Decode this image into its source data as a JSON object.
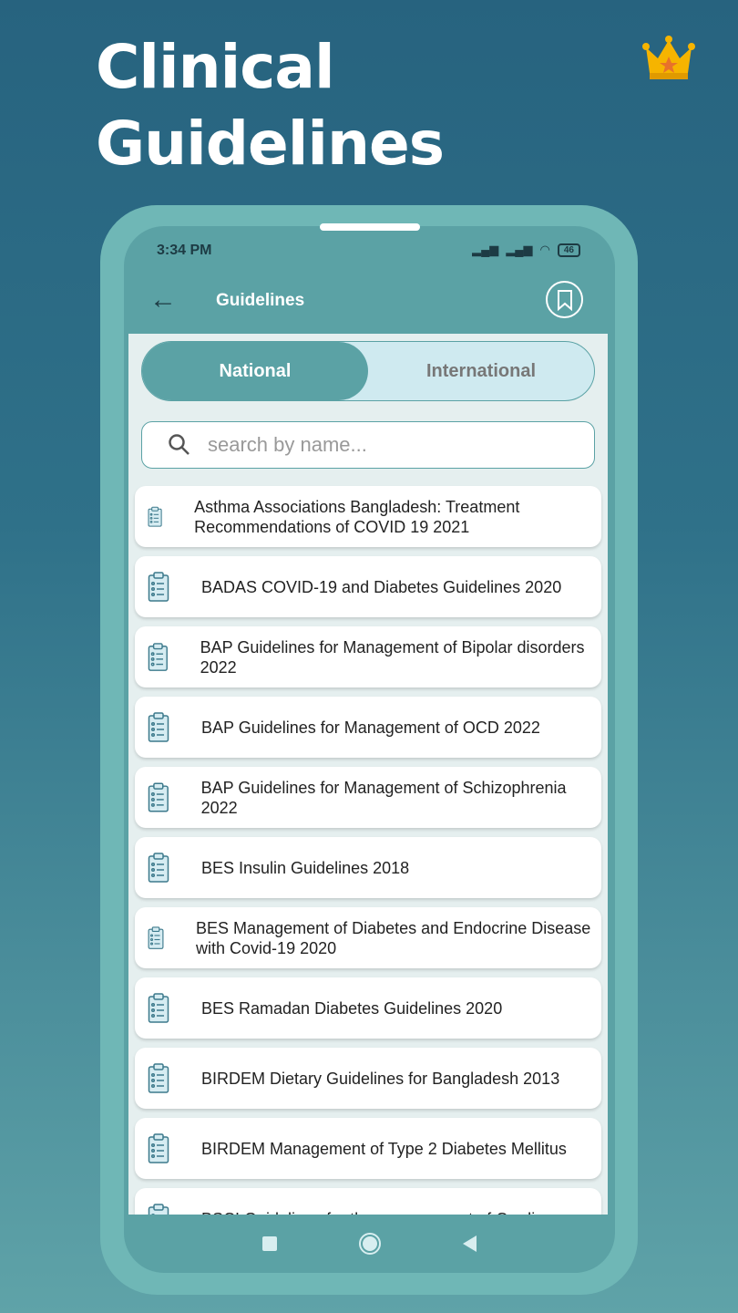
{
  "headline": {
    "line1": "Clinical",
    "line2": "Guidelines"
  },
  "status_bar": {
    "time": "3:34 PM",
    "battery": "46"
  },
  "app_bar": {
    "title": "Guidelines"
  },
  "tabs": [
    {
      "label": "National",
      "active": true
    },
    {
      "label": "International",
      "active": false
    }
  ],
  "search": {
    "placeholder": "search by name...",
    "value": ""
  },
  "guidelines": [
    "Asthma Associations Bangladesh: Treatment Recommendations of COVID 19 2021",
    "BADAS COVID-19 and Diabetes Guidelines 2020",
    "BAP Guidelines for Management of Bipolar disorders 2022",
    "BAP Guidelines for Management of OCD 2022",
    "BAP Guidelines for Management of Schizophrenia 2022",
    "BES Insulin Guidelines 2018",
    "BES Management of Diabetes and Endocrine Disease with Covid-19 2020",
    "BES Ramadan Diabetes Guidelines 2020",
    "BIRDEM Dietary Guidelines for Bangladesh 2013",
    "BIRDEM Management of Type 2 Diabetes Mellitus",
    "BSCI Guidelines for the management of Cardiac"
  ],
  "colors": {
    "accent": "#5ba2a5",
    "crown": "#f6b400"
  }
}
